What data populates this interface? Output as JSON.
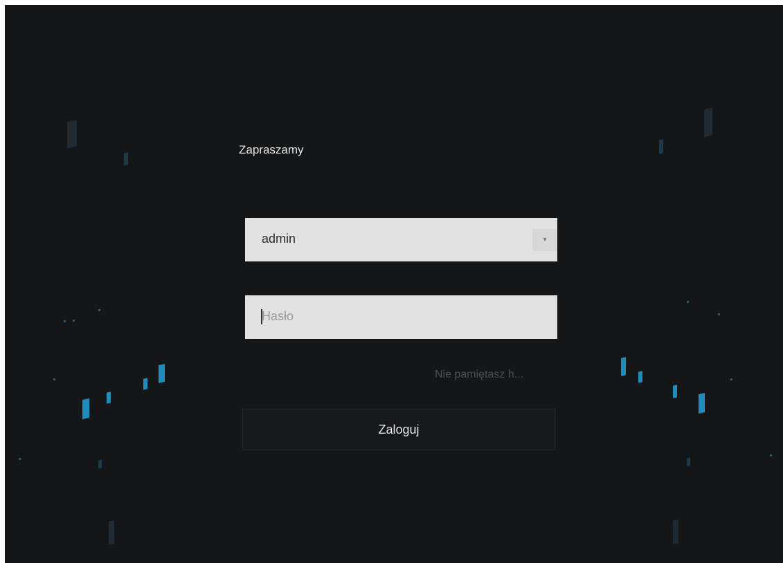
{
  "welcome_text": "Zapraszamy",
  "username": {
    "value": "admin",
    "dropdown_icon": "chevron-down-icon"
  },
  "password": {
    "placeholder": "Hasło"
  },
  "forgot_password_label": "Nie pamiętasz h...",
  "login_button_label": "Zaloguj",
  "colors": {
    "background": "#151617",
    "field": "#e2e2e2",
    "accent_tile": "#1a8fbf"
  }
}
